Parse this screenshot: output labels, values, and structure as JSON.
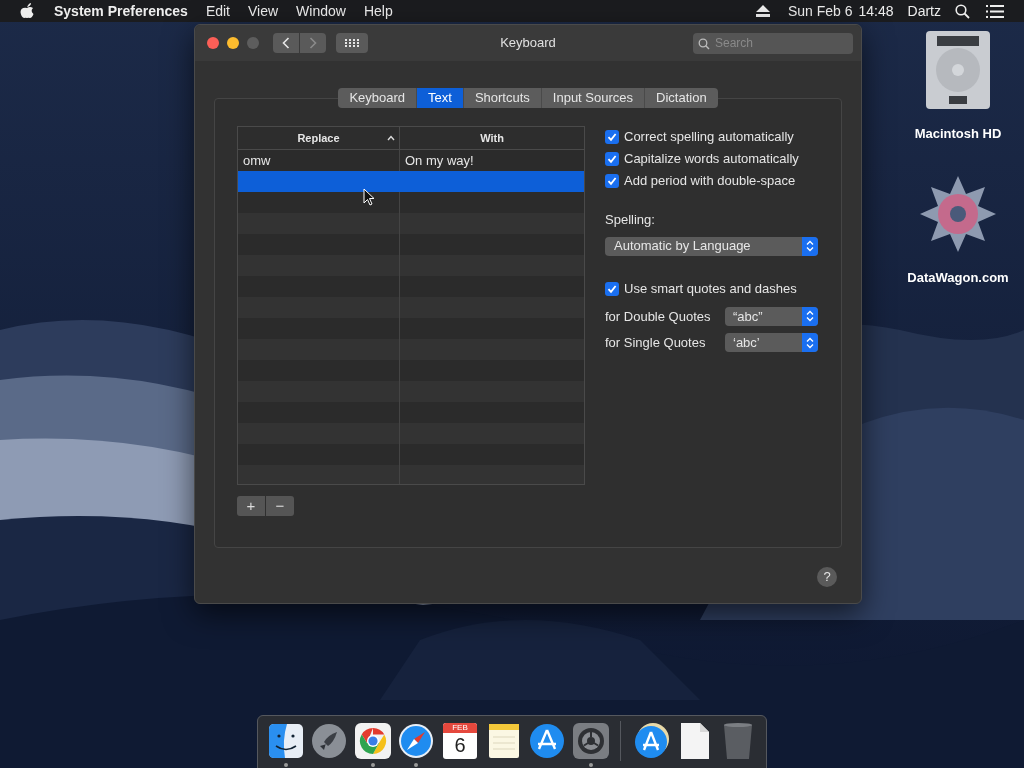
{
  "menu_bar": {
    "app_name": "System Preferences",
    "menus": [
      "Edit",
      "View",
      "Window",
      "Help"
    ],
    "date": "Sun Feb 6",
    "time": "14:48",
    "user": "Dartz"
  },
  "window": {
    "title": "Keyboard",
    "search": {
      "placeholder": "Search"
    },
    "nav": [
      {
        "kind": "back",
        "disabled": false
      },
      {
        "kind": "forward",
        "disabled": true
      }
    ]
  },
  "tabs": [
    {
      "label": "Keyboard",
      "selected": false
    },
    {
      "label": "Text",
      "selected": true
    },
    {
      "label": "Shortcuts",
      "selected": false
    },
    {
      "label": "Input Sources",
      "selected": false
    },
    {
      "label": "Dictation",
      "selected": false
    }
  ],
  "table": {
    "columns": [
      {
        "label": "Replace",
        "sorted": true
      },
      {
        "label": "With",
        "sorted": false
      }
    ],
    "rows": [
      {
        "replace": "omw",
        "with": "On my way!",
        "selected": false
      },
      {
        "selected": true
      }
    ]
  },
  "table_buttons": [
    "+",
    "−"
  ],
  "options": [
    {
      "label": "Correct spelling automatically",
      "checked": true
    },
    {
      "label": "Capitalize words automatically",
      "checked": true
    },
    {
      "label": "Add period with double-space",
      "checked": true
    }
  ],
  "spelling": {
    "label": "Spelling:",
    "value": "Automatic by Language"
  },
  "smart_quotes": {
    "label": "Use smart quotes and dashes",
    "checked": true
  },
  "quote_settings": [
    {
      "label": "for Double Quotes",
      "value": "“abc”"
    },
    {
      "label": "for Single Quotes",
      "value": "‘abc’"
    }
  ],
  "help_button": "?",
  "desktop_icons": [
    {
      "kind": "drive",
      "label": "Macintosh HD"
    },
    {
      "kind": "emblem",
      "label": "DataWagon.com"
    }
  ],
  "dock": {
    "apps": [
      {
        "kind": "finder",
        "running": true
      },
      {
        "kind": "rocket",
        "running": false
      },
      {
        "kind": "browser",
        "running": true
      },
      {
        "kind": "compass",
        "running": true
      },
      {
        "kind": "calendar",
        "running": false,
        "month": "FEB",
        "day": "6"
      },
      {
        "kind": "notes",
        "running": false
      },
      {
        "kind": "store",
        "running": false
      },
      {
        "kind": "gears",
        "running": true
      }
    ],
    "others": [
      {
        "kind": "stack"
      },
      {
        "kind": "document"
      },
      {
        "kind": "trash"
      }
    ]
  }
}
